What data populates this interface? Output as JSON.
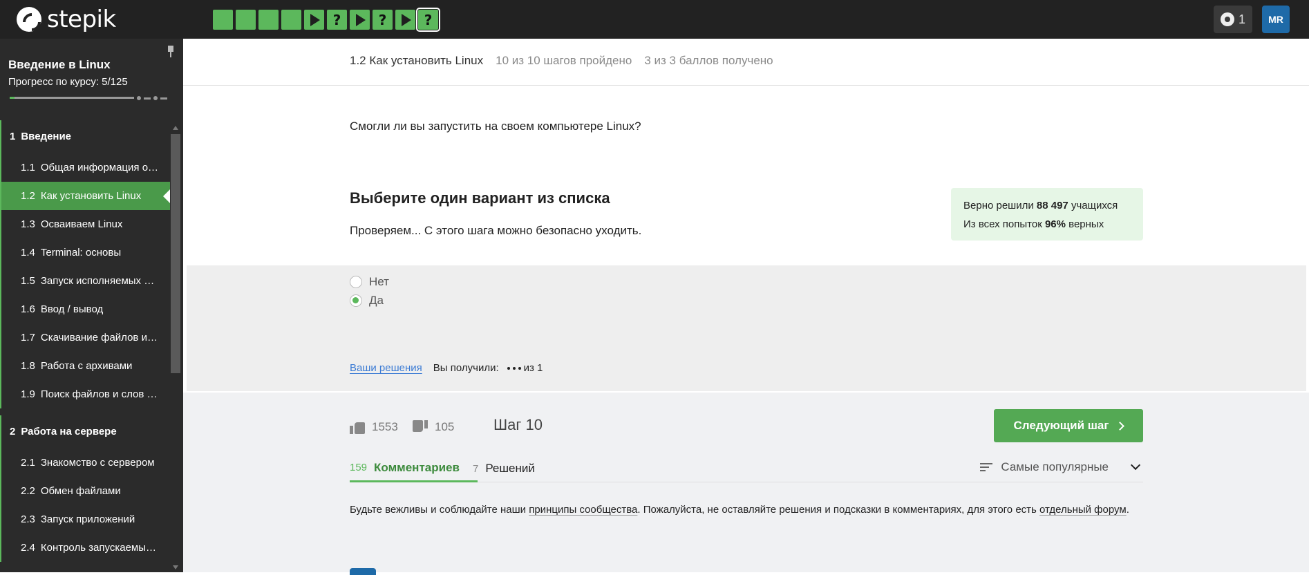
{
  "header": {
    "logo_text": "stepik",
    "steps": [
      {
        "kind": "text",
        "glyph": ""
      },
      {
        "kind": "text",
        "glyph": ""
      },
      {
        "kind": "text",
        "glyph": ""
      },
      {
        "kind": "text",
        "glyph": ""
      },
      {
        "kind": "video",
        "glyph": ""
      },
      {
        "kind": "quiz",
        "glyph": "?"
      },
      {
        "kind": "video",
        "glyph": ""
      },
      {
        "kind": "quiz",
        "glyph": "?"
      },
      {
        "kind": "video",
        "glyph": ""
      },
      {
        "kind": "quiz",
        "glyph": "?",
        "current": true
      }
    ],
    "award_count": "1",
    "avatar_initials": "MR"
  },
  "sidebar": {
    "course_title": "Введение в Linux",
    "progress_label": "Прогресс по курсу:",
    "progress_value": "5/125",
    "progress_fraction": 0.04,
    "sections": [
      {
        "num": "1",
        "title": "Введение",
        "lessons": [
          {
            "num": "1.1",
            "title": "Общая информация о курсе"
          },
          {
            "num": "1.2",
            "title": "Как установить Linux",
            "active": true
          },
          {
            "num": "1.3",
            "title": "Осваиваем Linux"
          },
          {
            "num": "1.4",
            "title": "Terminal: основы"
          },
          {
            "num": "1.5",
            "title": "Запуск исполняемых файлов"
          },
          {
            "num": "1.6",
            "title": "Ввод / вывод"
          },
          {
            "num": "1.7",
            "title": "Скачивание файлов из интернета"
          },
          {
            "num": "1.8",
            "title": "Работа с архивами"
          },
          {
            "num": "1.9",
            "title": "Поиск файлов и слов в файлах"
          }
        ]
      },
      {
        "num": "2",
        "title": "Работа на сервере",
        "lessons": [
          {
            "num": "2.1",
            "title": "Знакомство с сервером"
          },
          {
            "num": "2.2",
            "title": "Обмен файлами"
          },
          {
            "num": "2.3",
            "title": "Запуск приложений"
          },
          {
            "num": "2.4",
            "title": "Контроль запускаемых программ"
          }
        ]
      }
    ]
  },
  "lesson_bar": {
    "lesson": "1.2 Как установить Linux",
    "steps_done": "10 из 10 шагов пройдено",
    "points": "3 из 3 баллов  получено"
  },
  "step": {
    "question": "Смогли ли вы запустить на своем компьютере Linux?",
    "quiz_title": "Выберите один вариант из списка",
    "quiz_message": "Проверяем... С этого шага можно безопасно уходить.",
    "stats": {
      "line1_prefix": "Верно решили ",
      "line1_value": "88 497",
      "line1_suffix": " учащихся",
      "line2_prefix": "Из всех попыток ",
      "line2_value": "96%",
      "line2_suffix": " верных"
    },
    "options": [
      {
        "label": "Нет",
        "checked": false
      },
      {
        "label": "Да",
        "checked": true
      }
    ],
    "solutions_link": "Ваши решения",
    "score_label": "Вы получили:",
    "score_suffix": "из 1"
  },
  "footer": {
    "likes": "1553",
    "dislikes": "105",
    "step_label": "Шаг 10",
    "next_button": "Следующий шаг",
    "tabs": [
      {
        "count": "159",
        "label": "Комментариев",
        "active": true
      },
      {
        "count": "7",
        "label": "Решений",
        "active": false
      }
    ],
    "sort_label": "Самые популярные",
    "notice_1": "Будьте вежливы и соблюдайте наши ",
    "notice_link_1": "принципы сообщества",
    "notice_2": ". Пожалуйста, не оставляйте решения и подсказки в комментариях, для этого есть ",
    "notice_link_2": "отдельный форум",
    "notice_3": "."
  },
  "colors": {
    "accent_green": "#5cb85c",
    "topbar": "#222222",
    "sidebar": "#2b2b2b",
    "link_blue": "#3b7bd4",
    "avatar_blue": "#1e6aa8"
  }
}
